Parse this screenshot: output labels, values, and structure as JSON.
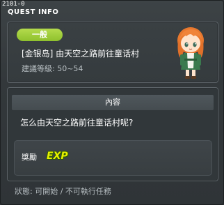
{
  "window": {
    "id_tag": "2101-0",
    "title": "QUEST INFO"
  },
  "quest": {
    "level_badge": "一般",
    "name": "[金银岛] 由天空之路前往童话村",
    "recommended_level": "建議等級: 50~54"
  },
  "content": {
    "header": "內容",
    "text": "怎么由天空之路前往童话村呢?",
    "reward_label": "獎勵",
    "reward_icon_text": "EXP"
  },
  "status": "狀態: 可開始 / 不可執行任務",
  "colors": {
    "level_badge": "#9ccb35",
    "exp_icon": "#e8f000"
  },
  "icons": {
    "npc": "npc-girl-orange-hair-portrait",
    "reward": "exp-icon"
  }
}
